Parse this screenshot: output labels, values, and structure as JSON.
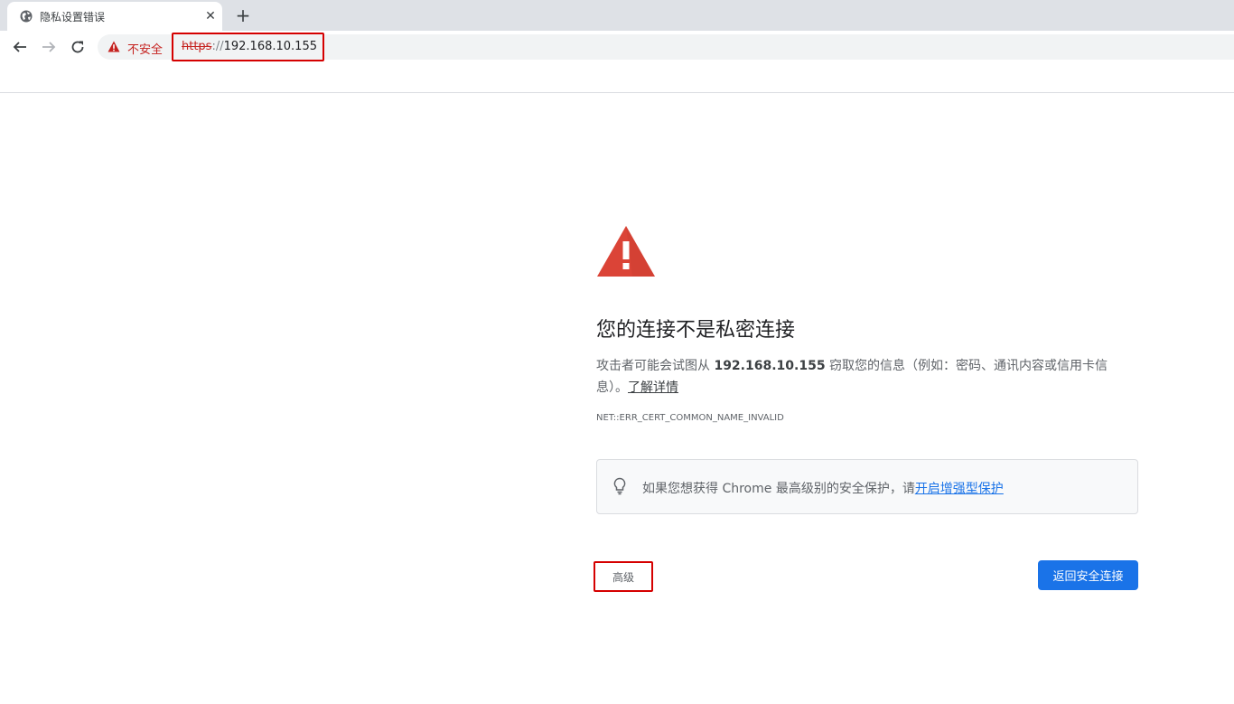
{
  "tab": {
    "title": "隐私设置错误",
    "close_glyph": "✕",
    "icon": "globe-icon"
  },
  "new_tab_glyph": "+",
  "toolbar": {
    "security_label": "不安全",
    "url_scheme": "https",
    "url_separator": "://",
    "url_host": "192.168.10.155"
  },
  "interstitial": {
    "heading": "您的连接不是私密连接",
    "explain_before": "攻击者可能会试图从 ",
    "explain_host": "192.168.10.155",
    "explain_after": " 窃取您的信息（例如：密码、通讯内容或信用卡信息）。",
    "learn_more": "了解详情",
    "error_code": "NET::ERR_CERT_COMMON_NAME_INVALID",
    "enhanced_text": "如果您想获得 Chrome 最高级别的安全保护，请",
    "enhanced_link": "开启增强型保护",
    "advanced_label": "高级",
    "back_label": "返回安全连接"
  },
  "colors": {
    "alert_red": "#db4437",
    "primary_blue": "#1a73e8",
    "highlight_red": "#d50000"
  }
}
